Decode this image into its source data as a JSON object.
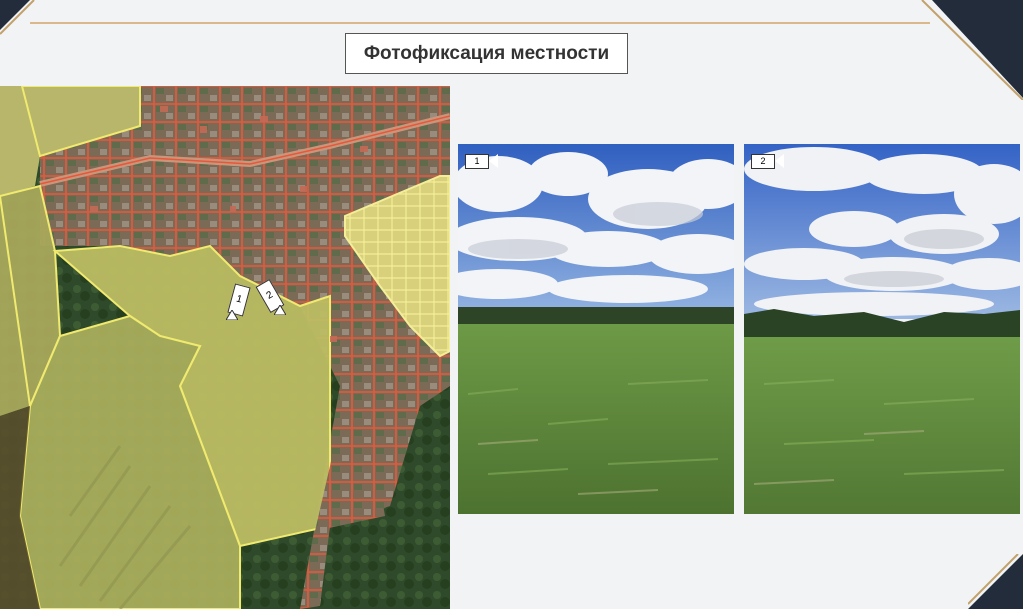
{
  "header": {
    "title": "Фотофиксация местности"
  },
  "map": {
    "markers": [
      {
        "label": "1"
      },
      {
        "label": "2"
      }
    ],
    "colors": {
      "parcel_outline": "#e8573a",
      "zone_fill": "#c9c85a",
      "zone_outline": "#f0ea70"
    }
  },
  "photos": [
    {
      "label": "1"
    },
    {
      "label": "2"
    }
  ],
  "colors": {
    "accent": "#d9b98a",
    "frame_dark": "#232c3b",
    "frame_gold": "#c2a16b"
  }
}
